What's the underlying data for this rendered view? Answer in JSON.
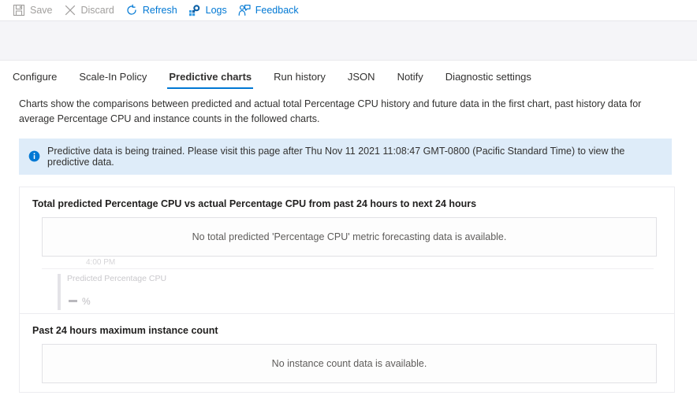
{
  "toolbar": {
    "buttons": [
      {
        "label": "Save",
        "icon": "save-icon",
        "disabled": true
      },
      {
        "label": "Discard",
        "icon": "discard-icon",
        "disabled": true
      },
      {
        "label": "Refresh",
        "icon": "refresh-icon",
        "disabled": false
      },
      {
        "label": "Logs",
        "icon": "logs-icon",
        "disabled": false
      },
      {
        "label": "Feedback",
        "icon": "feedback-icon",
        "disabled": false
      }
    ]
  },
  "tabs": [
    {
      "label": "Configure",
      "active": false
    },
    {
      "label": "Scale-In Policy",
      "active": false
    },
    {
      "label": "Predictive charts",
      "active": true
    },
    {
      "label": "Run history",
      "active": false
    },
    {
      "label": "JSON",
      "active": false
    },
    {
      "label": "Notify",
      "active": false
    },
    {
      "label": "Diagnostic settings",
      "active": false
    }
  ],
  "description": "Charts show the comparisons between predicted and actual total Percentage CPU history and future data in the first chart, past history data for average Percentage CPU and instance counts in the followed charts.",
  "info_banner": {
    "icon": "info-icon",
    "message": "Predictive data is being trained. Please visit this page after Thu Nov 11 2021 11:08:47 GMT-0800 (Pacific Standard Time) to view the predictive data."
  },
  "cards": [
    {
      "title": "Total predicted Percentage CPU vs actual Percentage CPU from past 24 hours to next 24 hours",
      "empty_message": "No total predicted 'Percentage CPU' metric forecasting data is available.",
      "ghost": {
        "tick_label": "4:00 PM",
        "legend_label": "Predicted Percentage CPU",
        "value_unit": "%"
      }
    },
    {
      "title": "Past 24 hours maximum instance count",
      "empty_message": "No instance count data is available."
    }
  ],
  "colors": {
    "accent": "#0078d4",
    "info_banner_bg": "#deecf9",
    "disabled_text": "#a19f9d",
    "band_bg": "#f5f5f8"
  },
  "chart_data": {
    "type": "line",
    "title": "Total predicted Percentage CPU vs actual Percentage CPU from past 24 hours to next 24 hours",
    "xlabel": "",
    "ylabel": "Predicted Percentage CPU",
    "categories": [
      "4:00 PM"
    ],
    "series": [
      {
        "name": "Predicted Percentage CPU",
        "values": [],
        "unit": "%"
      }
    ],
    "empty": true,
    "empty_message": "No total predicted 'Percentage CPU' metric forecasting data is available.",
    "legend_position": "bottom-left",
    "grid": false
  }
}
